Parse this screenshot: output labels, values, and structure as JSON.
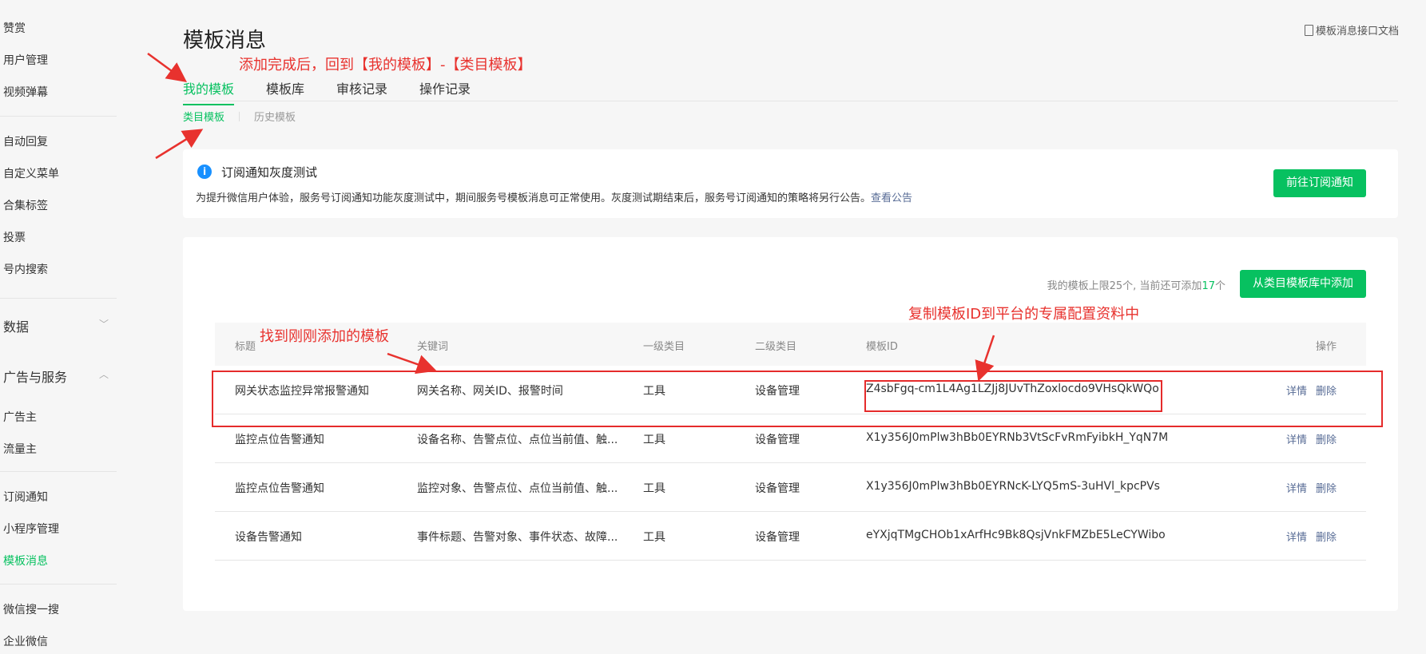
{
  "sidebar": {
    "items": [
      {
        "label": "赞赏",
        "active": false
      },
      {
        "label": "用户管理",
        "active": false
      },
      {
        "label": "视频弹幕",
        "active": false
      },
      {
        "label": "自动回复",
        "active": false
      },
      {
        "label": "自定义菜单",
        "active": false
      },
      {
        "label": "合集标签",
        "active": false
      },
      {
        "label": "投票",
        "active": false
      },
      {
        "label": "号内搜索",
        "active": false
      },
      {
        "label": "广告主",
        "active": false
      },
      {
        "label": "流量主",
        "active": false
      },
      {
        "label": "订阅通知",
        "active": false
      },
      {
        "label": "小程序管理",
        "active": false
      },
      {
        "label": "模板消息",
        "active": true
      },
      {
        "label": "微信搜一搜",
        "active": false
      },
      {
        "label": "企业微信",
        "active": false
      }
    ],
    "groups": [
      {
        "label": "数据",
        "expanded": false
      },
      {
        "label": "广告与服务",
        "expanded": true
      }
    ]
  },
  "header": {
    "title": "模板消息",
    "doc_link": "模板消息接口文档"
  },
  "tabs": [
    {
      "label": "我的模板",
      "active": true
    },
    {
      "label": "模板库",
      "active": false
    },
    {
      "label": "审核记录",
      "active": false
    },
    {
      "label": "操作记录",
      "active": false
    }
  ],
  "subtabs": [
    {
      "label": "类目模板",
      "active": true
    },
    {
      "label": "历史模板",
      "active": false
    }
  ],
  "notice": {
    "icon": "info-icon",
    "icon_glyph": "i",
    "title": "订阅通知灰度测试",
    "description": "为提升微信用户体验，服务号订阅通知功能灰度测试中，期间服务号模板消息可正常使用。灰度测试期结束后，服务号订阅通知的策略将另行公告。",
    "link": "查看公告",
    "button": "前往订阅通知"
  },
  "limit": {
    "prefix": "我的模板上限25个, 当前还可添加",
    "count": "17",
    "suffix": "个"
  },
  "add_button": "从类目模板库中添加",
  "table": {
    "headers": [
      "标题",
      "关键词",
      "一级类目",
      "二级类目",
      "模板ID",
      "操作"
    ],
    "rows": [
      {
        "title": "网关状态监控异常报警通知",
        "keywords": "网关名称、网关ID、报警时间",
        "cat1": "工具",
        "cat2": "设备管理",
        "id": "Z4sbFgq-cm1L4Ag1LZJj8JUvThZoxlocdo9VHsQkWQo",
        "ops": [
          "详情",
          "删除"
        ]
      },
      {
        "title": "监控点位告警通知",
        "keywords": "设备名称、告警点位、点位当前值、触...",
        "cat1": "工具",
        "cat2": "设备管理",
        "id": "X1y356J0mPlw3hBb0EYRNb3VtScFvRmFyibkH_YqN7M",
        "ops": [
          "详情",
          "删除"
        ]
      },
      {
        "title": "监控点位告警通知",
        "keywords": "监控对象、告警点位、点位当前值、触...",
        "cat1": "工具",
        "cat2": "设备管理",
        "id": "X1y356J0mPlw3hBb0EYRNcK-LYQ5mS-3uHVl_kpcPVs",
        "ops": [
          "详情",
          "删除"
        ]
      },
      {
        "title": "设备告警通知",
        "keywords": "事件标题、告警对象、事件状态、故障...",
        "cat1": "工具",
        "cat2": "设备管理",
        "id": "eYXjqTMgCHOb1xArfHc9Bk8QsjVnkFMZbE5LeCYWibo",
        "ops": [
          "详情",
          "删除"
        ]
      }
    ]
  },
  "annotations": {
    "tip1": "添加完成后，回到【我的模板】-【类目模板】",
    "tip2": "找到刚刚添加的模板",
    "tip3": "复制模板ID到平台的专属配置资料中",
    "color": "#e8322e"
  },
  "colors": {
    "accent": "#07c160",
    "link": "#576b95",
    "info": "#1890ff"
  }
}
